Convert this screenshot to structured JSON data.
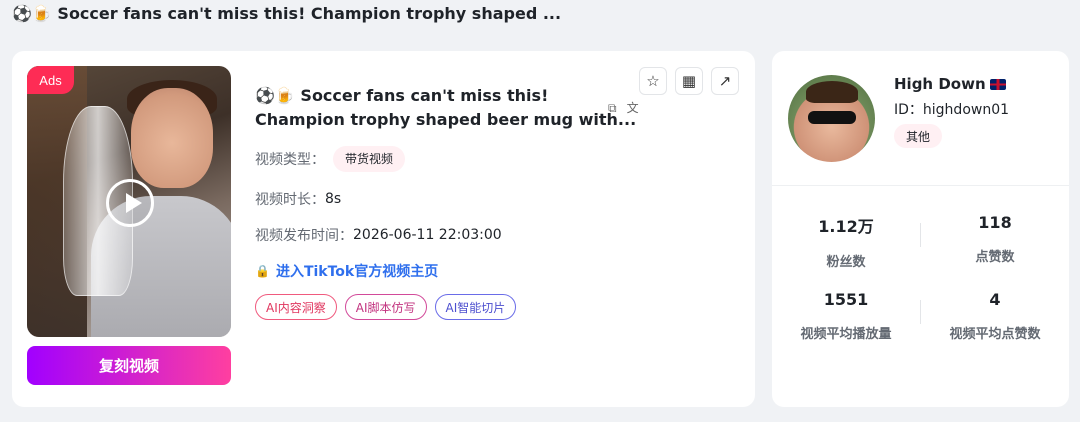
{
  "page": {
    "title": "⚽🍺 Soccer fans can't miss this! Champion trophy shaped ..."
  },
  "video": {
    "ads_label": "Ads",
    "copy_button": "复刻视频",
    "title_line1": "⚽🍺 Soccer fans can't miss this!",
    "title_line2": "Champion trophy shaped beer mug with...",
    "type_label": "视频类型：",
    "type_value": "带货视频",
    "duration_label": "视频时长：",
    "duration_value": "8s",
    "publish_label": "视频发布时间：",
    "publish_value": "2026-06-11 22:03:00",
    "tiktok_link": "进入TikTok官方视频主页",
    "ai_tags": [
      "AI内容洞察",
      "AI脚本仿写",
      "AI智能切片"
    ],
    "icons": {
      "copy": "copy-icon",
      "translate": "translate-icon",
      "favorite": "star-icon",
      "qrcode": "qrcode-icon",
      "external": "external-link-icon",
      "lock": "lock-icon",
      "play": "play-icon"
    }
  },
  "author": {
    "name": "High Down",
    "id": "ID：highdown01",
    "category": "其他"
  },
  "stats": [
    {
      "value": "1.12万",
      "label": "粉丝数"
    },
    {
      "value": "118",
      "label": "点赞数"
    },
    {
      "value": "1551",
      "label": "视频平均播放量"
    },
    {
      "value": "4",
      "label": "视频平均点赞数"
    }
  ],
  "colors": {
    "accent_pink": "#fe2c55",
    "link_blue": "#2f6fed",
    "gradient_start": "#a100ff",
    "gradient_end": "#ff3fa0"
  }
}
